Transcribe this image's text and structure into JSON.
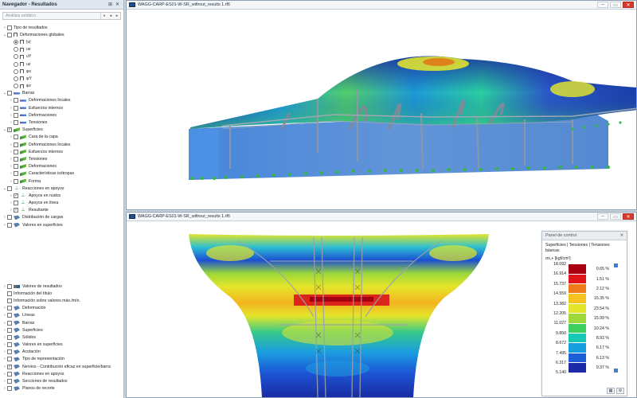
{
  "navigator": {
    "title": "Navegador - Resultados",
    "pin_icon": "pin-icon",
    "close_icon": "close-icon",
    "combo_value": "Análisis estático",
    "tree_top": [
      {
        "label": "Tipo de resultados",
        "depth": 0,
        "exp": "›",
        "check": "box",
        "checked": false,
        "icon": ""
      },
      {
        "label": "Deformaciones globales",
        "depth": 0,
        "exp": "⌄",
        "check": "box",
        "checked": false,
        "icon": "frame"
      },
      {
        "label": "|u|",
        "depth": 1,
        "exp": "",
        "check": "radio",
        "checked": true,
        "icon": "frame"
      },
      {
        "label": "ux",
        "depth": 1,
        "exp": "",
        "check": "radio",
        "checked": false,
        "icon": "frame"
      },
      {
        "label": "uY",
        "depth": 1,
        "exp": "",
        "check": "radio",
        "checked": false,
        "icon": "frame"
      },
      {
        "label": "uz",
        "depth": 1,
        "exp": "",
        "check": "radio",
        "checked": false,
        "icon": "frame"
      },
      {
        "label": "φx",
        "depth": 1,
        "exp": "",
        "check": "radio",
        "checked": false,
        "icon": "frame"
      },
      {
        "label": "φY",
        "depth": 1,
        "exp": "",
        "check": "radio",
        "checked": false,
        "icon": "frame"
      },
      {
        "label": "φz",
        "depth": 1,
        "exp": "",
        "check": "radio",
        "checked": false,
        "icon": "frame"
      },
      {
        "label": "Barras",
        "depth": 0,
        "exp": "⌄",
        "check": "box",
        "checked": false,
        "icon": "bar"
      },
      {
        "label": "Deformaciones locales",
        "depth": 1,
        "exp": "›",
        "check": "box",
        "checked": false,
        "icon": "bar"
      },
      {
        "label": "Esfuerzos internos",
        "depth": 1,
        "exp": "›",
        "check": "box",
        "checked": false,
        "icon": "bar"
      },
      {
        "label": "Deformaciones",
        "depth": 1,
        "exp": "›",
        "check": "box",
        "checked": false,
        "icon": "bar"
      },
      {
        "label": "Tensiones",
        "depth": 1,
        "exp": "›",
        "check": "box",
        "checked": false,
        "icon": "bar"
      },
      {
        "label": "Superficies",
        "depth": 0,
        "exp": "⌄",
        "check": "box",
        "checked": true,
        "icon": "surf"
      },
      {
        "label": "Cara de la capa",
        "depth": 1,
        "exp": "›",
        "check": "box",
        "checked": false,
        "icon": "surf"
      },
      {
        "label": "Deformaciones locales",
        "depth": 1,
        "exp": "›",
        "check": "box",
        "checked": false,
        "icon": "surf"
      },
      {
        "label": "Esfuerzos internos",
        "depth": 1,
        "exp": "›",
        "check": "box",
        "checked": false,
        "icon": "surf"
      },
      {
        "label": "Tensiones",
        "depth": 1,
        "exp": "›",
        "check": "box",
        "checked": false,
        "icon": "surf"
      },
      {
        "label": "Deformaciones",
        "depth": 1,
        "exp": "›",
        "check": "box",
        "checked": false,
        "icon": "surf"
      },
      {
        "label": "Características isótropas",
        "depth": 1,
        "exp": "›",
        "check": "box",
        "checked": false,
        "icon": "surf"
      },
      {
        "label": "Forma",
        "depth": 1,
        "exp": "›",
        "check": "box",
        "checked": false,
        "icon": "surf"
      },
      {
        "label": "Reacciones en apoyos",
        "depth": 0,
        "exp": "⌄",
        "check": "box",
        "checked": false,
        "icon": "sup"
      },
      {
        "label": "Apoyos en nudos",
        "depth": 1,
        "exp": "›",
        "check": "box",
        "checked": true,
        "icon": "sup"
      },
      {
        "label": "Apoyos en línea",
        "depth": 1,
        "exp": "›",
        "check": "box",
        "checked": false,
        "icon": "sup"
      },
      {
        "label": "Resultante",
        "depth": 1,
        "exp": "›",
        "check": "box",
        "checked": true,
        "icon": "sup"
      },
      {
        "label": "Distribución de cargas",
        "depth": 0,
        "exp": "›",
        "check": "box",
        "checked": false,
        "icon": "gen"
      },
      {
        "label": "Valores en superficies",
        "depth": 0,
        "exp": "›",
        "check": "box",
        "checked": false,
        "icon": "gen"
      }
    ],
    "tree_bottom": [
      {
        "label": "Valores de resultados",
        "depth": 0,
        "exp": "›",
        "checked": false,
        "icon": "lvl"
      },
      {
        "label": "Información del título",
        "depth": 0,
        "exp": "",
        "checked": false,
        "icon": ""
      },
      {
        "label": "Información sobre valores máx./mín.",
        "depth": 0,
        "exp": "",
        "checked": false,
        "icon": ""
      },
      {
        "label": "Deformación",
        "depth": 0,
        "exp": "›",
        "checked": false,
        "icon": "gen"
      },
      {
        "label": "Líneas",
        "depth": 0,
        "exp": "›",
        "checked": false,
        "icon": "gen"
      },
      {
        "label": "Barras",
        "depth": 0,
        "exp": "›",
        "checked": false,
        "icon": "gen"
      },
      {
        "label": "Superficies",
        "depth": 0,
        "exp": "›",
        "checked": false,
        "icon": "gen"
      },
      {
        "label": "Sólidos",
        "depth": 0,
        "exp": "›",
        "checked": false,
        "icon": "gen"
      },
      {
        "label": "Valores en superficies",
        "depth": 0,
        "exp": "›",
        "checked": false,
        "icon": "gen"
      },
      {
        "label": "Acotación",
        "depth": 0,
        "exp": "›",
        "checked": false,
        "icon": "gen"
      },
      {
        "label": "Tipo de representación",
        "depth": 0,
        "exp": "›",
        "checked": false,
        "icon": "gen"
      },
      {
        "label": "Nervios - Contribución eficaz en superficie/barra",
        "depth": 0,
        "exp": "›",
        "checked": true,
        "icon": "gen"
      },
      {
        "label": "Reacciones en apoyos",
        "depth": 0,
        "exp": "›",
        "checked": false,
        "icon": "gen"
      },
      {
        "label": "Secciones de resultados",
        "depth": 0,
        "exp": "›",
        "checked": false,
        "icon": "gen"
      },
      {
        "label": "Planos de recorte",
        "depth": 0,
        "exp": "›",
        "checked": false,
        "icon": "gen"
      }
    ]
  },
  "viewport_top": {
    "title": "WAGG-CARP-ES01-W-SR_without_results 1.rf6"
  },
  "viewport_bottom": {
    "title": "WAGG-CARP-ES01-W-SR_without_results 1.rf6"
  },
  "window_buttons": {
    "minimize": "─",
    "restore": "▭",
    "close": "✕"
  },
  "control_panel": {
    "title": "Panel de control",
    "subtitle": "Superficies | Tensiones | Tensiones básicas",
    "quantity": "σx,+ [kgf/cm²]",
    "legend_values": [
      "18.092",
      "16.914",
      "15.737",
      "14.559",
      "13.382",
      "12.205",
      "11.027",
      "9.850",
      "8.672",
      "7.495",
      "6.317",
      "5.140"
    ],
    "legend_percents": [
      "0.65 %",
      "1.51 %",
      "2.12 %",
      "15.35 %",
      "23.54 %",
      "15.99 %",
      "10.24 %",
      "8.93 %",
      "6.17 %",
      "6.13 %",
      "9.37 %"
    ],
    "legend_colors": [
      "#a80012",
      "#e0141b",
      "#ef7a1a",
      "#f6c21f",
      "#e3e52a",
      "#9fd83a",
      "#3fcf5e",
      "#17c9b5",
      "#169edf",
      "#1c5fd6",
      "#1c2aa8"
    ]
  }
}
